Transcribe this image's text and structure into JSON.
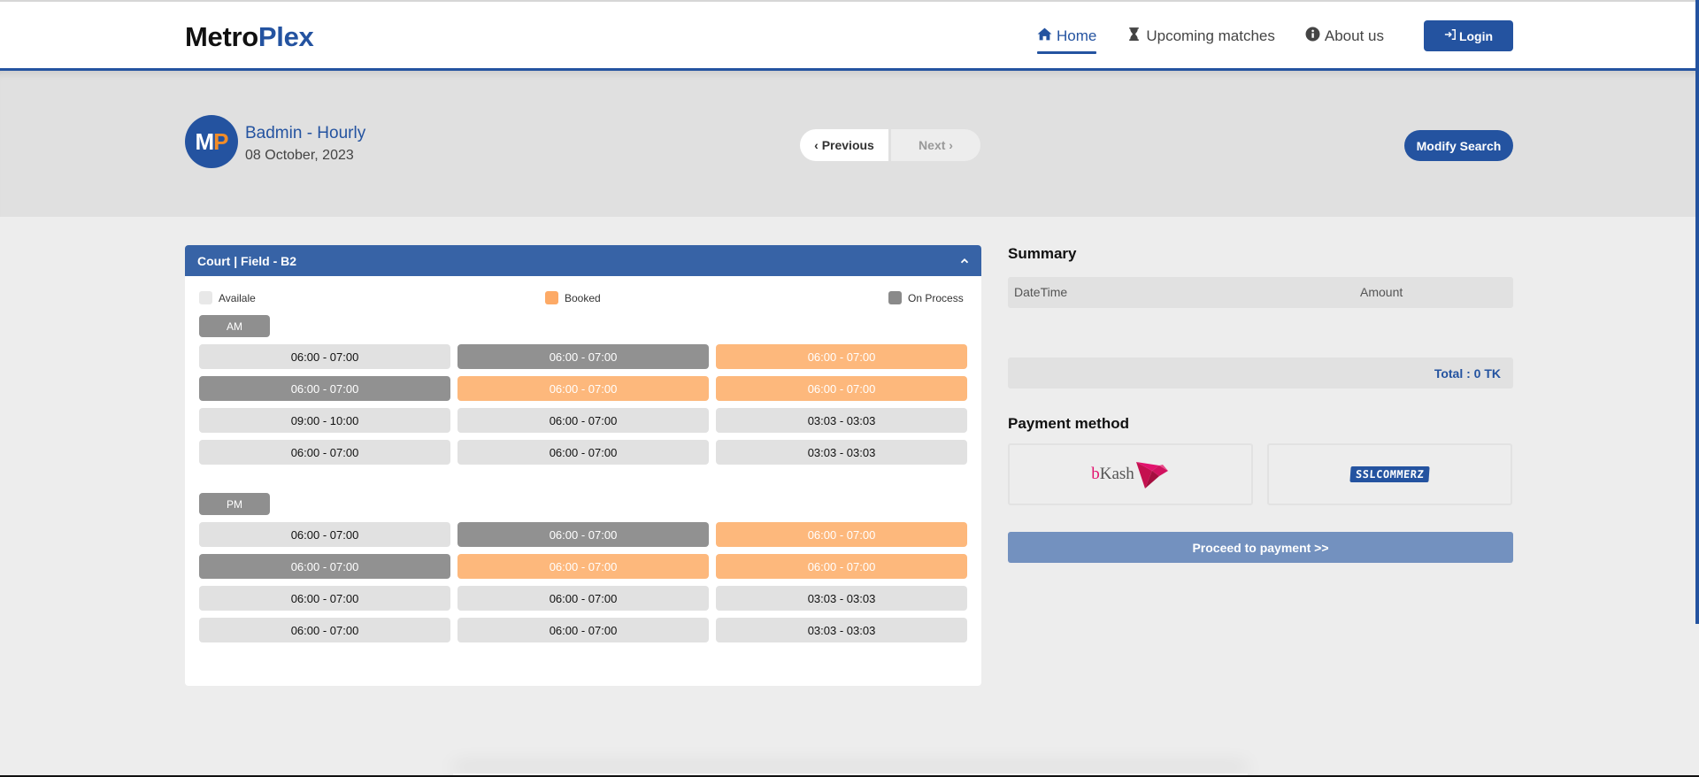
{
  "navbar": {
    "brand_part1": "Metro",
    "brand_part2": "Plex",
    "links": [
      {
        "label": "Home",
        "icon": "home-icon",
        "active": true
      },
      {
        "label": "Upcoming matches",
        "icon": "hourglass-icon",
        "active": false
      },
      {
        "label": "About us",
        "icon": "info-circle-icon",
        "active": false
      }
    ],
    "login_label": "Login",
    "login_icon": "sign-in-icon"
  },
  "hero": {
    "avatar_letter1": "M",
    "avatar_letter2": "P",
    "title": "Badmin - Hourly",
    "date": "08 October, 2023",
    "prev_label": "‹ Previous",
    "next_label": "Next ›",
    "modify_label": "Modify Search"
  },
  "court": {
    "title": "Court | Field - B2",
    "collapse_icon": "chevron-up-icon",
    "legend": {
      "available": "Availale",
      "booked": "Booked",
      "process": "On Process"
    },
    "colors": {
      "available": "#e1e1e1",
      "booked": "#fdb87c",
      "process": "#919191",
      "header": "#3763a6"
    },
    "am_label": "AM",
    "pm_label": "PM",
    "am_slots": [
      {
        "time": "06:00 - 07:00",
        "status": "available"
      },
      {
        "time": "06:00 - 07:00",
        "status": "process"
      },
      {
        "time": "06:00 - 07:00",
        "status": "booked"
      },
      {
        "time": "06:00 - 07:00",
        "status": "process"
      },
      {
        "time": "06:00 - 07:00",
        "status": "booked"
      },
      {
        "time": "06:00 - 07:00",
        "status": "booked"
      },
      {
        "time": "09:00 - 10:00",
        "status": "available"
      },
      {
        "time": "06:00 - 07:00",
        "status": "available"
      },
      {
        "time": "03:03 - 03:03",
        "status": "available"
      },
      {
        "time": "06:00 - 07:00",
        "status": "available"
      },
      {
        "time": "06:00 - 07:00",
        "status": "available"
      },
      {
        "time": "03:03 - 03:03",
        "status": "available"
      }
    ],
    "pm_slots": [
      {
        "time": "06:00 - 07:00",
        "status": "available"
      },
      {
        "time": "06:00 - 07:00",
        "status": "process"
      },
      {
        "time": "06:00 - 07:00",
        "status": "booked"
      },
      {
        "time": "06:00 - 07:00",
        "status": "process"
      },
      {
        "time": "06:00 - 07:00",
        "status": "booked"
      },
      {
        "time": "06:00 - 07:00",
        "status": "booked"
      },
      {
        "time": "06:00 - 07:00",
        "status": "available"
      },
      {
        "time": "06:00 - 07:00",
        "status": "available"
      },
      {
        "time": "03:03 - 03:03",
        "status": "available"
      },
      {
        "time": "06:00 - 07:00",
        "status": "available"
      },
      {
        "time": "06:00 - 07:00",
        "status": "available"
      },
      {
        "time": "03:03 - 03:03",
        "status": "available"
      }
    ]
  },
  "summary": {
    "title": "Summary",
    "col_datetime": "DateTime",
    "col_amount": "Amount",
    "rows": [],
    "total": "Total : 0 TK",
    "payment_title": "Payment method",
    "payment_options": [
      {
        "name": "bKash",
        "logo_part1": "b",
        "logo_part2": "Kash"
      },
      {
        "name": "SSLCommerz",
        "logo_text": "SSLCOMMERZ"
      }
    ],
    "proceed_label": "Proceed to payment >>"
  },
  "theme": {
    "primary": "#2453a0",
    "accent": "#f28c28"
  }
}
